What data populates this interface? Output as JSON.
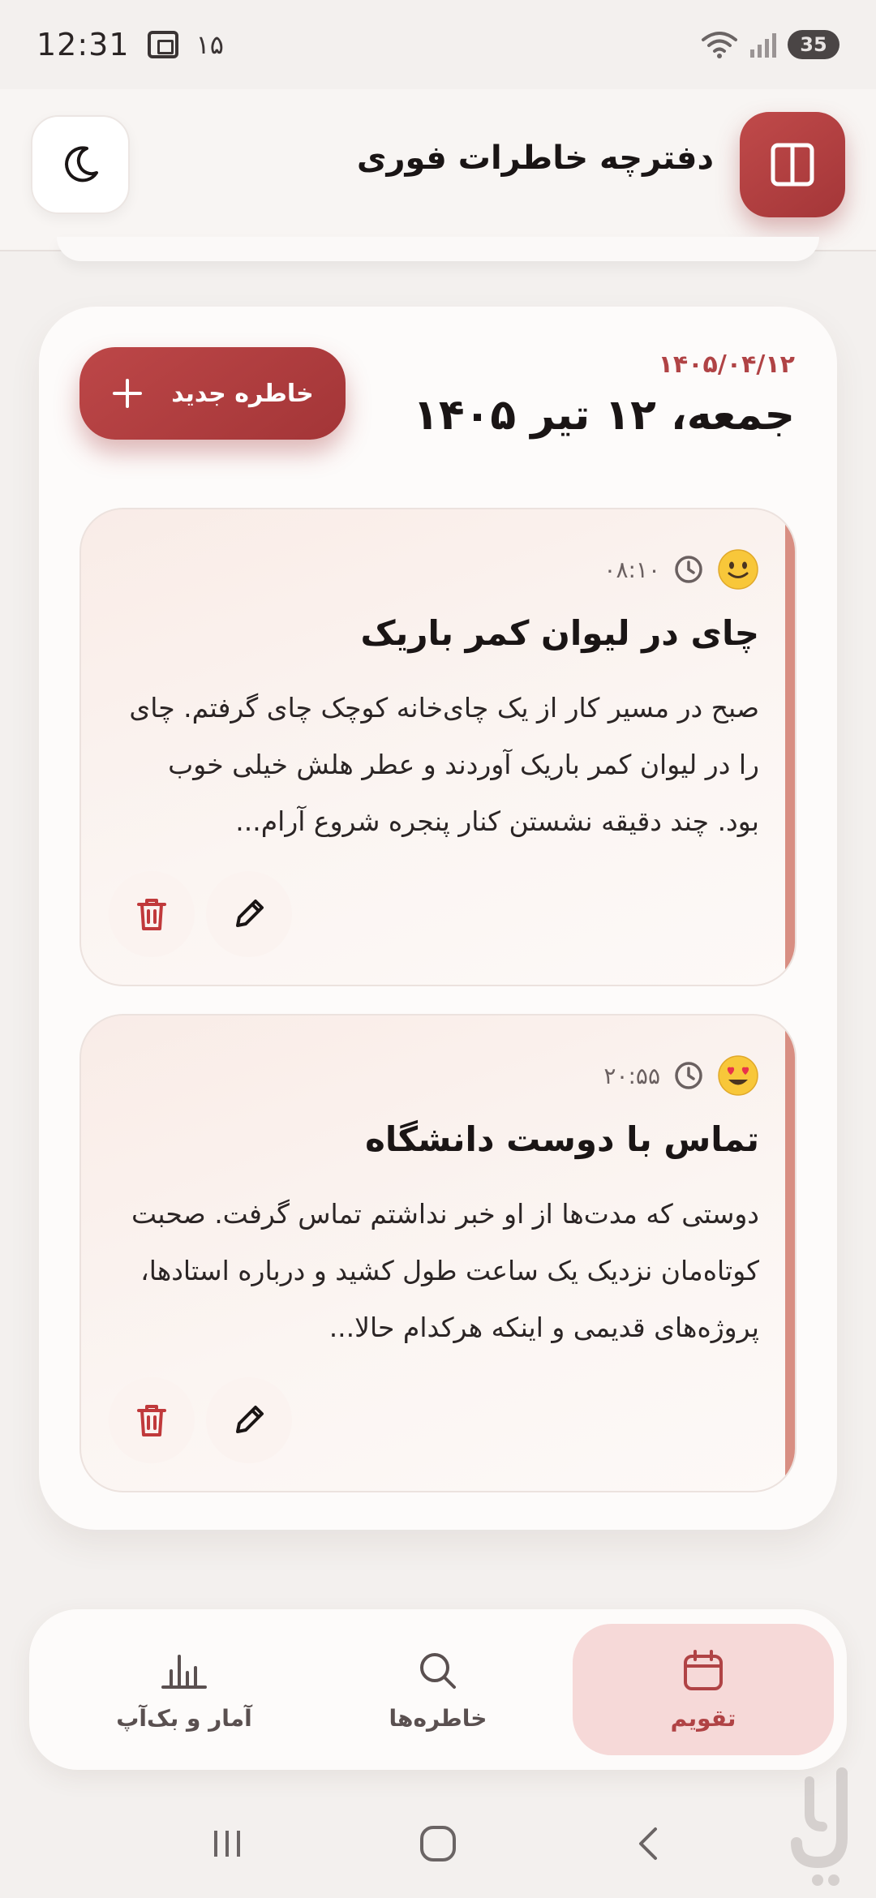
{
  "status_bar": {
    "time": "12:31",
    "notif_count": "۱۵",
    "battery": "35"
  },
  "header": {
    "title": "دفترچه خاطرات فوری"
  },
  "day": {
    "date_short": "۱۴۰۵/۰۴/۱۲",
    "title": "جمعه، ۱۲ تیر ۱۴۰۵",
    "new_memory_label": "خاطره جدید"
  },
  "memories": [
    {
      "mood": "slightly-smiling",
      "time": "۰۸:۱۰",
      "title": "چای در لیوان کمر باریک",
      "body": "صبح در مسیر کار از یک چای‌خانه کوچک چای گرفتم. چای را در لیوان کمر باریک آوردند و عطر هلش خیلی خوب بود. چند دقیقه نشستن کنار پنجره شروع آرام..."
    },
    {
      "mood": "heart-eyes",
      "time": "۲۰:۵۵",
      "title": "تماس با دوست دانشگاه",
      "body": "دوستی که مدت‌ها از او خبر نداشتم تماس گرفت. صحبت کوتاه‌مان نزدیک یک ساعت طول کشید و درباره استادها، پروژه‌های قدیمی و اینکه هرکدام حالا..."
    }
  ],
  "bottom_nav": {
    "calendar": "تقویم",
    "memories": "خاطره‌ها",
    "stats": "آمار و بک‌آپ"
  },
  "colors": {
    "accent": "#b04345",
    "accent_light": "#f6d9d8",
    "card_stripe": "#d88e82"
  }
}
